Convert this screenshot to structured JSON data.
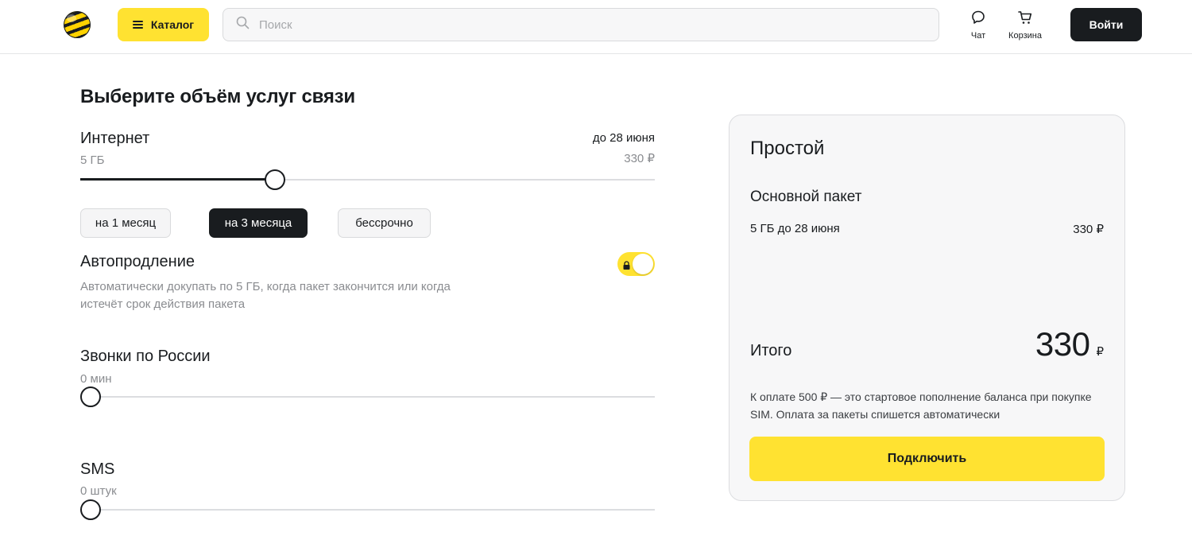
{
  "header": {
    "catalog_label": "Каталог",
    "search_placeholder": "Поиск",
    "chat_label": "Чат",
    "cart_label": "Корзина",
    "login_label": "Войти"
  },
  "main": {
    "title": "Выберите объём услуг связи",
    "internet": {
      "title": "Интернет",
      "amount": "5 ГБ",
      "until": "до 28 июня",
      "price": "330 ₽",
      "slider_fraction": 0.339
    },
    "periods": [
      {
        "label": "на 1 месяц",
        "active": false
      },
      {
        "label": "на 3 месяца",
        "active": true
      },
      {
        "label": "бессрочно",
        "active": false
      }
    ],
    "autorenew": {
      "title": "Автопродление",
      "description": "Автоматически докупать по 5 ГБ, когда пакет закончится или когда истечёт срок действия пакета",
      "enabled": true
    },
    "calls": {
      "title": "Звонки по России",
      "amount": "0 мин",
      "slider_fraction": 0
    },
    "sms": {
      "title": "SMS",
      "amount": "0 штук",
      "slider_fraction": 0
    }
  },
  "summary": {
    "title": "Простой",
    "package_title": "Основной пакет",
    "package_line": "5 ГБ до 28 июня",
    "package_price": "330 ₽",
    "total_label": "Итого",
    "total_value": "330",
    "total_currency": "₽",
    "note": "К оплате 500 ₽ — это стартовое пополнение баланса при покупке SIM. Оплата за пакеты спишется автоматически",
    "connect_label": "Подключить"
  },
  "colors": {
    "accent_yellow": "#ffe231",
    "dark": "#191c1f",
    "muted_text": "#8a8c90"
  },
  "icons": [
    "logo",
    "menu-icon",
    "search-icon",
    "chat-icon",
    "cart-icon",
    "lock-icon"
  ]
}
